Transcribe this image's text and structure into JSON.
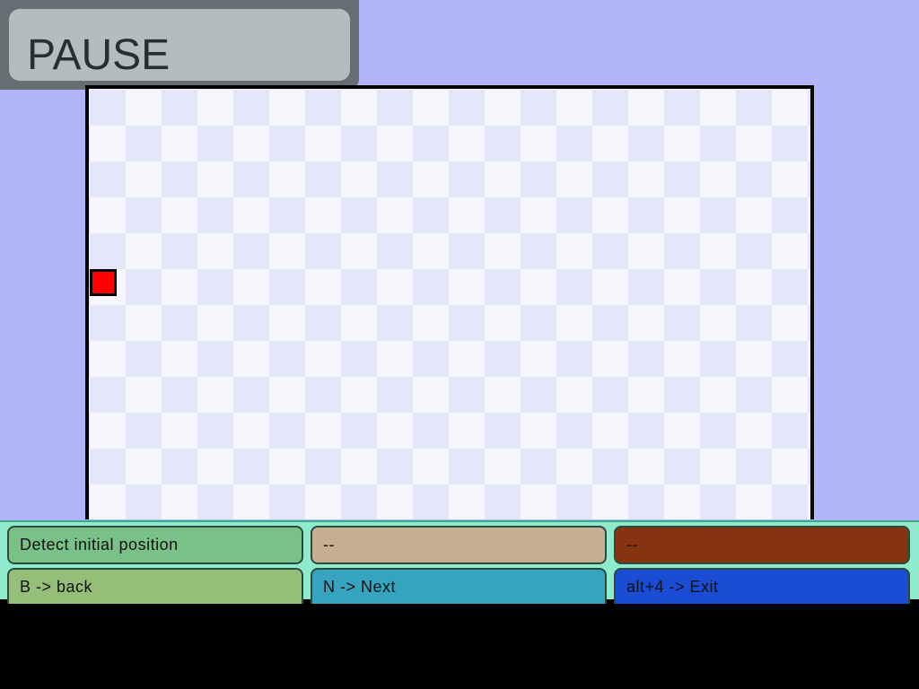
{
  "pause": {
    "label": "PAUSE"
  },
  "controls": {
    "row1": [
      {
        "label": "Detect initial position",
        "color": "#7ac187"
      },
      {
        "label": "--",
        "color": "#c6ae92"
      },
      {
        "label": "--",
        "color": "#86340f"
      }
    ],
    "row2": [
      {
        "label": "B -> back",
        "color": "#95be78"
      },
      {
        "label": "N -> Next",
        "color": "#36a3bf"
      },
      {
        "label": "alt+4 -> Exit",
        "color": "#1b4dd4"
      }
    ]
  },
  "colors": {
    "background": "#b3b5fb",
    "board_light": "#f6f6fd",
    "board_dark": "#e6e6fb",
    "player": "#ff0000"
  }
}
